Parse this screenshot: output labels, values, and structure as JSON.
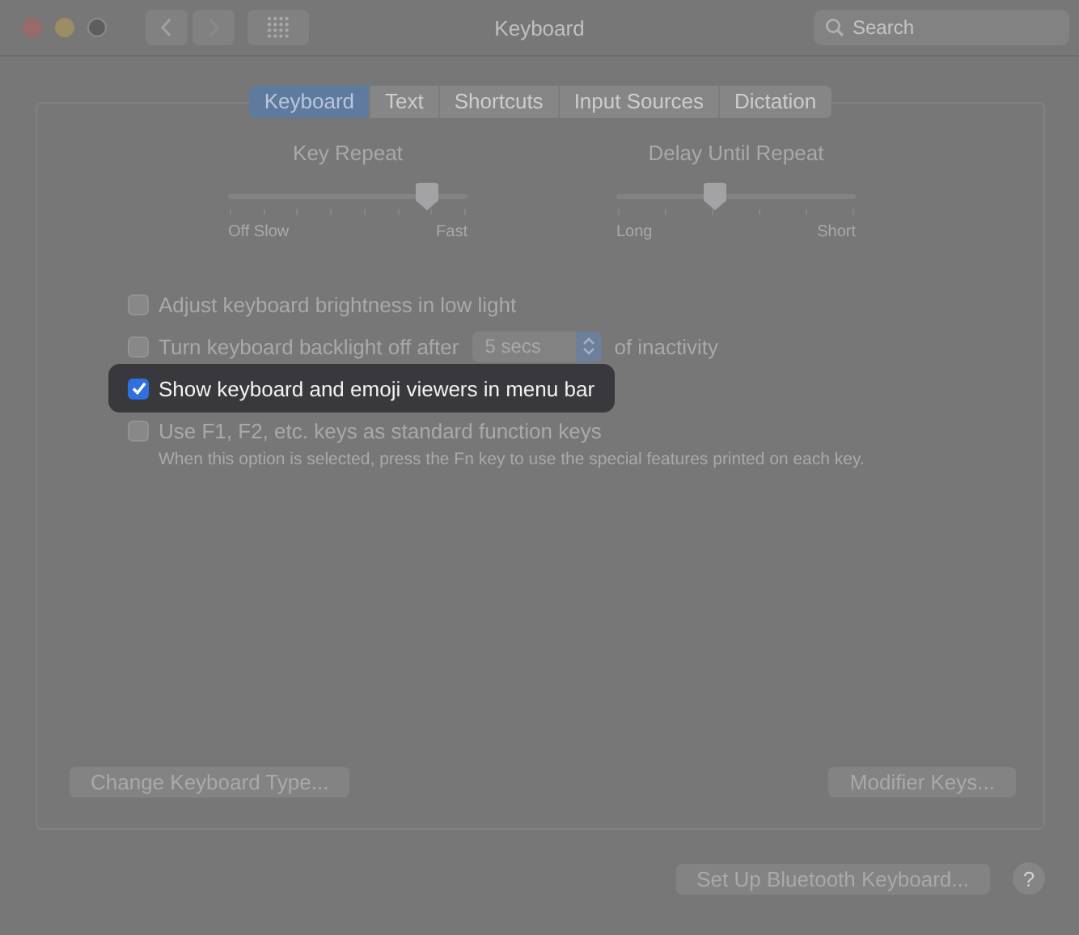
{
  "window": {
    "title": "Keyboard"
  },
  "search": {
    "placeholder": "Search"
  },
  "tabs": [
    {
      "label": "Keyboard",
      "selected": true
    },
    {
      "label": "Text",
      "selected": false
    },
    {
      "label": "Shortcuts",
      "selected": false
    },
    {
      "label": "Input Sources",
      "selected": false
    },
    {
      "label": "Dictation",
      "selected": false
    }
  ],
  "sliders": [
    {
      "title": "Key Repeat",
      "level": 0.83,
      "min_label": "Off  Slow",
      "max_label": "Fast"
    },
    {
      "title": "Delay Until Repeat",
      "level": 0.41,
      "min_label": "Long",
      "max_label": "Short"
    }
  ],
  "options": [
    {
      "kind": "checkbox",
      "label": "Adjust keyboard brightness in low light",
      "checked": false,
      "highlighted": false
    },
    {
      "kind": "select",
      "label": "Turn keyboard backlight off after",
      "checked": false,
      "highlighted": false,
      "value": "5 secs",
      "suffix": "of inactivity"
    },
    {
      "kind": "checkbox",
      "label": "Show keyboard and emoji viewers in menu bar",
      "checked": true,
      "highlighted": true
    },
    {
      "kind": "checkbox",
      "label": "Use F1, F2, etc. keys as standard function keys",
      "checked": false,
      "highlighted": false,
      "hint": "When this option is selected, press the Fn key to use the special features printed on each key."
    }
  ],
  "panel_buttons": [
    "Change Keyboard Type...",
    "Modifier Keys..."
  ],
  "footer": {
    "button": "Set Up Bluetooth Keyboard...",
    "help": "?"
  }
}
